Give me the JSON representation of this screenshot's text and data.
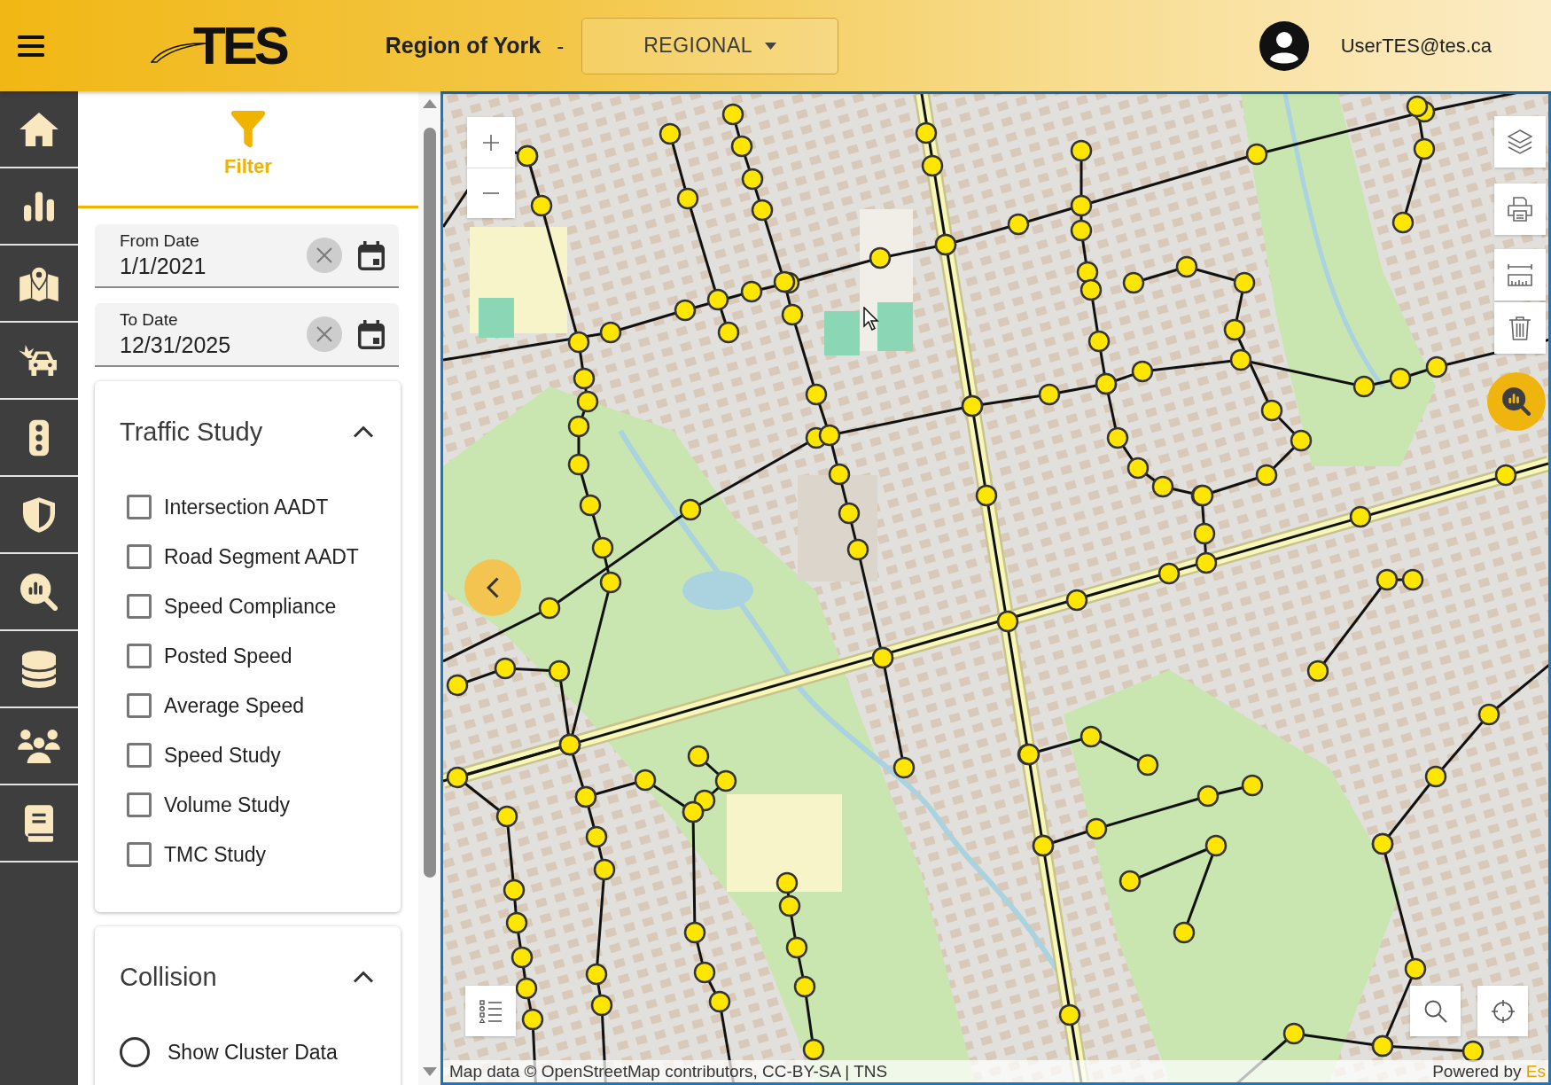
{
  "header": {
    "logo": "TES",
    "region": "Region of York",
    "separator": "-",
    "scope_dropdown": {
      "value": "REGIONAL"
    },
    "user": {
      "email": "UserTES@tes.ca"
    }
  },
  "sidebar": {
    "items": [
      {
        "kind": "home",
        "selected": false
      },
      {
        "kind": "charts",
        "selected": false
      },
      {
        "kind": "map",
        "selected": false
      },
      {
        "kind": "collision",
        "selected": false
      },
      {
        "kind": "signals",
        "selected": false
      },
      {
        "kind": "safety",
        "selected": false
      },
      {
        "kind": "analysis",
        "selected": false
      },
      {
        "kind": "database",
        "selected": false
      },
      {
        "kind": "users",
        "selected": false
      },
      {
        "kind": "reports",
        "selected": false
      }
    ]
  },
  "filter_panel": {
    "title": "Filter",
    "date_fields": [
      {
        "label": "From Date",
        "value": "1/1/2021"
      },
      {
        "label": "To Date",
        "value": "12/31/2025"
      }
    ],
    "sections": [
      {
        "title": "Traffic Study",
        "expanded": true,
        "options": [
          {
            "kind": "checkbox",
            "label": "Intersection AADT",
            "checked": false
          },
          {
            "kind": "checkbox",
            "label": "Road Segment AADT",
            "checked": false
          },
          {
            "kind": "checkbox",
            "label": "Speed Compliance",
            "checked": false
          },
          {
            "kind": "checkbox",
            "label": "Posted Speed",
            "checked": false
          },
          {
            "kind": "checkbox",
            "label": "Average Speed",
            "checked": false
          },
          {
            "kind": "checkbox",
            "label": "Speed Study",
            "checked": false
          },
          {
            "kind": "checkbox",
            "label": "Volume Study",
            "checked": false
          },
          {
            "kind": "checkbox",
            "label": "TMC Study",
            "checked": false
          }
        ]
      },
      {
        "title": "Collision",
        "expanded": true,
        "options": [
          {
            "kind": "radio",
            "label": "Show Cluster Data",
            "selected": false
          }
        ]
      }
    ]
  },
  "map": {
    "attribution": "Map data © OpenStreetMap contributors, CC-BY-SA | TNS",
    "powered_by": {
      "text": "Powered by",
      "link": "Es"
    }
  }
}
